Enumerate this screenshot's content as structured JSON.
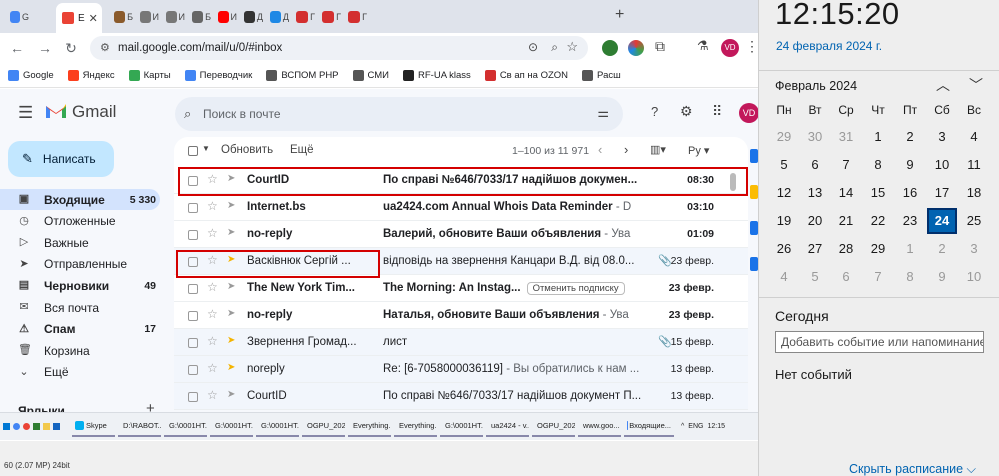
{
  "browser": {
    "active_tab_label": "E",
    "url": "mail.google.com/mail/u/0/#inbox",
    "profile_initials": "VD",
    "tabs": [
      {
        "label": "G",
        "color": "#4285f4"
      },
      {
        "label": "Б",
        "color": "#8a5a2b"
      },
      {
        "label": "И",
        "color": "#777777"
      },
      {
        "label": "И",
        "color": "#777777"
      },
      {
        "label": "Б",
        "color": "#666666"
      },
      {
        "label": "И",
        "color": "#ff0000"
      },
      {
        "label": "Д",
        "color": "#333333"
      },
      {
        "label": "Д",
        "color": "#1e88e5"
      },
      {
        "label": "Г",
        "color": "#d32f2f"
      },
      {
        "label": "Г",
        "color": "#d32f2f"
      },
      {
        "label": "Г",
        "color": "#d32f2f"
      }
    ],
    "bookmarks": [
      {
        "label": "Google",
        "color": "#4285f4"
      },
      {
        "label": "Яндекс",
        "color": "#fc3f1d"
      },
      {
        "label": "Карты",
        "color": "#34a853"
      },
      {
        "label": "Переводчик",
        "color": "#4285f4"
      },
      {
        "label": "ВСПОМ РНР",
        "color": "#555555"
      },
      {
        "label": "СМИ",
        "color": "#555555"
      },
      {
        "label": "RF-UA klass",
        "color": "#222222"
      },
      {
        "label": "Св ап на OZON",
        "color": "#d32f2f"
      },
      {
        "label": "Расш",
        "color": "#555555"
      }
    ]
  },
  "gmail": {
    "logo": "Gmail",
    "search_placeholder": "Поиск в почте",
    "compose": "Написать",
    "nav": [
      {
        "label": "Входящие",
        "count": "5 330",
        "bold": true,
        "selected": true,
        "icon": "inbox-icon",
        "glyph": "▣"
      },
      {
        "label": "Отложенные",
        "count": "",
        "bold": false,
        "selected": false,
        "icon": "clock-icon",
        "glyph": "◷"
      },
      {
        "label": "Важные",
        "count": "",
        "bold": false,
        "selected": false,
        "icon": "important-icon",
        "glyph": "▷"
      },
      {
        "label": "Отправленные",
        "count": "",
        "bold": false,
        "selected": false,
        "icon": "send-icon",
        "glyph": "➤"
      },
      {
        "label": "Черновики",
        "count": "49",
        "bold": true,
        "selected": false,
        "icon": "draft-icon",
        "glyph": "▤"
      },
      {
        "label": "Вся почта",
        "count": "",
        "bold": false,
        "selected": false,
        "icon": "all-mail-icon",
        "glyph": "✉"
      },
      {
        "label": "Спам",
        "count": "17",
        "bold": true,
        "selected": false,
        "icon": "spam-icon",
        "glyph": "⚠"
      },
      {
        "label": "Корзина",
        "count": "",
        "bold": false,
        "selected": false,
        "icon": "trash-icon",
        "glyph": "🗑"
      },
      {
        "label": "Ещё",
        "count": "",
        "bold": false,
        "selected": false,
        "icon": "chevron-down-icon",
        "glyph": "⌄"
      }
    ],
    "labels_heading": "Ярлыки",
    "toolbar": {
      "refresh": "Обновить",
      "more": "Ещё",
      "range": "1–100 из 11 971",
      "lang": "Ру"
    },
    "emails": [
      {
        "sender": "CourtID",
        "subject": "По справі №646/7033/17 надійшов докумен...",
        "snippet": "",
        "date": "08:30",
        "unread": true,
        "important": false,
        "attachment": false,
        "unsubscribe": ""
      },
      {
        "sender": "Internet.bs",
        "subject": "ua2424.com Annual Whois Data Reminder",
        "snippet": " - D",
        "date": "03:10",
        "unread": true,
        "important": false,
        "attachment": false,
        "unsubscribe": ""
      },
      {
        "sender": "no-reply",
        "subject": "Валерий, обновите Ваши объявления",
        "snippet": " - Ува",
        "date": "01:09",
        "unread": true,
        "important": false,
        "attachment": false,
        "unsubscribe": ""
      },
      {
        "sender": "Васківнюк Сергій ...",
        "subject": "відповідь на звернення Канцари В.Д. від 08.0...",
        "snippet": "",
        "date": "23 февр.",
        "unread": false,
        "important": true,
        "attachment": true,
        "unsubscribe": ""
      },
      {
        "sender": "The New York Tim...",
        "subject": "The Morning: An Instag...",
        "snippet": "",
        "date": "23 февр.",
        "unread": true,
        "important": false,
        "attachment": false,
        "unsubscribe": "Отменить подписку"
      },
      {
        "sender": "no-reply",
        "subject": "Наталья, обновите Ваши объявления",
        "snippet": " - Ува",
        "date": "23 февр.",
        "unread": true,
        "important": false,
        "attachment": false,
        "unsubscribe": ""
      },
      {
        "sender": "Звернення Громад...",
        "subject": "лист",
        "snippet": "",
        "date": "15 февр.",
        "unread": false,
        "important": true,
        "attachment": true,
        "unsubscribe": ""
      },
      {
        "sender": "noreply",
        "subject": "Re: [6-7058000036119]",
        "snippet": " - Вы обратились к нам ...",
        "date": "13 февр.",
        "unread": false,
        "important": true,
        "attachment": false,
        "unsubscribe": ""
      },
      {
        "sender": "CourtID",
        "subject": "По справі №646/7033/17 надійшов документ П...",
        "snippet": "",
        "date": "13 февр.",
        "unread": false,
        "important": false,
        "attachment": false,
        "unsubscribe": ""
      }
    ]
  },
  "taskbar": {
    "items": [
      {
        "label": "Skype",
        "color": "#00aff0"
      },
      {
        "label": "D:\\RABOT...",
        "color": "#f2c94c"
      },
      {
        "label": "G:\\0001HT...",
        "color": "#f2c94c"
      },
      {
        "label": "G:\\0001HT...",
        "color": "#f2c94c"
      },
      {
        "label": "G:\\0001HT...",
        "color": "#f2c94c"
      },
      {
        "label": "OGPU_202...",
        "color": "#e53935"
      },
      {
        "label": "Everything...",
        "color": "#ff7043"
      },
      {
        "label": "Everything...",
        "color": "#ff7043"
      },
      {
        "label": "G:\\0001HT...",
        "color": "#f2c94c"
      },
      {
        "label": "ua2424 - v...",
        "color": "#e53935"
      },
      {
        "label": "OGPU_202...",
        "color": "#e53935"
      },
      {
        "label": "www.goo...",
        "color": "#4caf50"
      },
      {
        "label": "Входящие...",
        "color": "#4285f4"
      }
    ],
    "lang": "ENG",
    "time": "12:15",
    "status_text": "60 (2.07 MP)   24bit"
  },
  "clock": {
    "time": "12:15:20",
    "date": "24 февраля 2024 г.",
    "month": "Февраль 2024",
    "weekdays": [
      "Пн",
      "Вт",
      "Ср",
      "Чт",
      "Пт",
      "Сб",
      "Вс"
    ],
    "weeks": [
      [
        [
          "29",
          1
        ],
        [
          "30",
          1
        ],
        [
          "31",
          1
        ],
        [
          "1",
          0
        ],
        [
          "2",
          0
        ],
        [
          "3",
          0
        ],
        [
          "4",
          0
        ]
      ],
      [
        [
          "5",
          0
        ],
        [
          "6",
          0
        ],
        [
          "7",
          0
        ],
        [
          "8",
          0
        ],
        [
          "9",
          0
        ],
        [
          "10",
          0
        ],
        [
          "11",
          0
        ]
      ],
      [
        [
          "12",
          0
        ],
        [
          "13",
          0
        ],
        [
          "14",
          0
        ],
        [
          "15",
          0
        ],
        [
          "16",
          0
        ],
        [
          "17",
          0
        ],
        [
          "18",
          0
        ]
      ],
      [
        [
          "19",
          0
        ],
        [
          "20",
          0
        ],
        [
          "21",
          0
        ],
        [
          "22",
          0
        ],
        [
          "23",
          0
        ],
        [
          "24",
          2
        ],
        [
          "25",
          0
        ]
      ],
      [
        [
          "26",
          0
        ],
        [
          "27",
          0
        ],
        [
          "28",
          0
        ],
        [
          "29",
          0
        ],
        [
          "1",
          1
        ],
        [
          "2",
          1
        ],
        [
          "3",
          1
        ]
      ],
      [
        [
          "4",
          1
        ],
        [
          "5",
          1
        ],
        [
          "6",
          1
        ],
        [
          "7",
          1
        ],
        [
          "8",
          1
        ],
        [
          "9",
          1
        ],
        [
          "10",
          1
        ]
      ]
    ],
    "today_heading": "Сегодня",
    "event_placeholder": "Добавить событие или напоминание",
    "no_events": "Нет событий",
    "hide_schedule": "Скрыть расписание ⌵"
  }
}
